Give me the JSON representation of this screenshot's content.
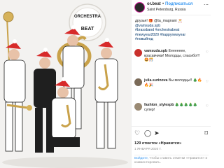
{
  "post": {
    "username": "or.beat",
    "follow_label": "Подписаться",
    "location": "Saint Petersburg, Russia",
    "photo": {
      "drum_text_top": "ORCHESTRA",
      "drum_text_bottom": "BEAT",
      "description": "Brass band of six musicians in Santa hats and patterned pajamas with sousaphone, trombone and saxophones"
    },
    "caption_lines": [
      "друзья! 🎁 @ta_magnani 🎅",
      "@vamsuda.spb",
      "#brassband #orchestrabeat",
      "#newyear2020 #happynewyear",
      "#новыйгод"
    ],
    "comments": [
      {
        "user": "vamsuda.spb",
        "text": "Ееееееее, красавчики! Молодцы, спасибо!!! 🤩🎊",
        "color": "#c9302c"
      },
      {
        "user": "julia.surinova",
        "text": "Вы молодцы!! 🎄🔥🔥🎉",
        "color": "#7a6a58"
      },
      {
        "user": "fashion_stylespb",
        "text": "🎄🎄🎄🎄🎄 супер!",
        "color": "#9a8a74"
      }
    ],
    "likes_text": "129 отметок «Нравится»",
    "date_text": "1 ЯНВАРЯ 2020 Г.",
    "login_text_link": "Войдите,",
    "login_text_rest": "чтобы ставить отметки «Нравится» и комментировать."
  }
}
